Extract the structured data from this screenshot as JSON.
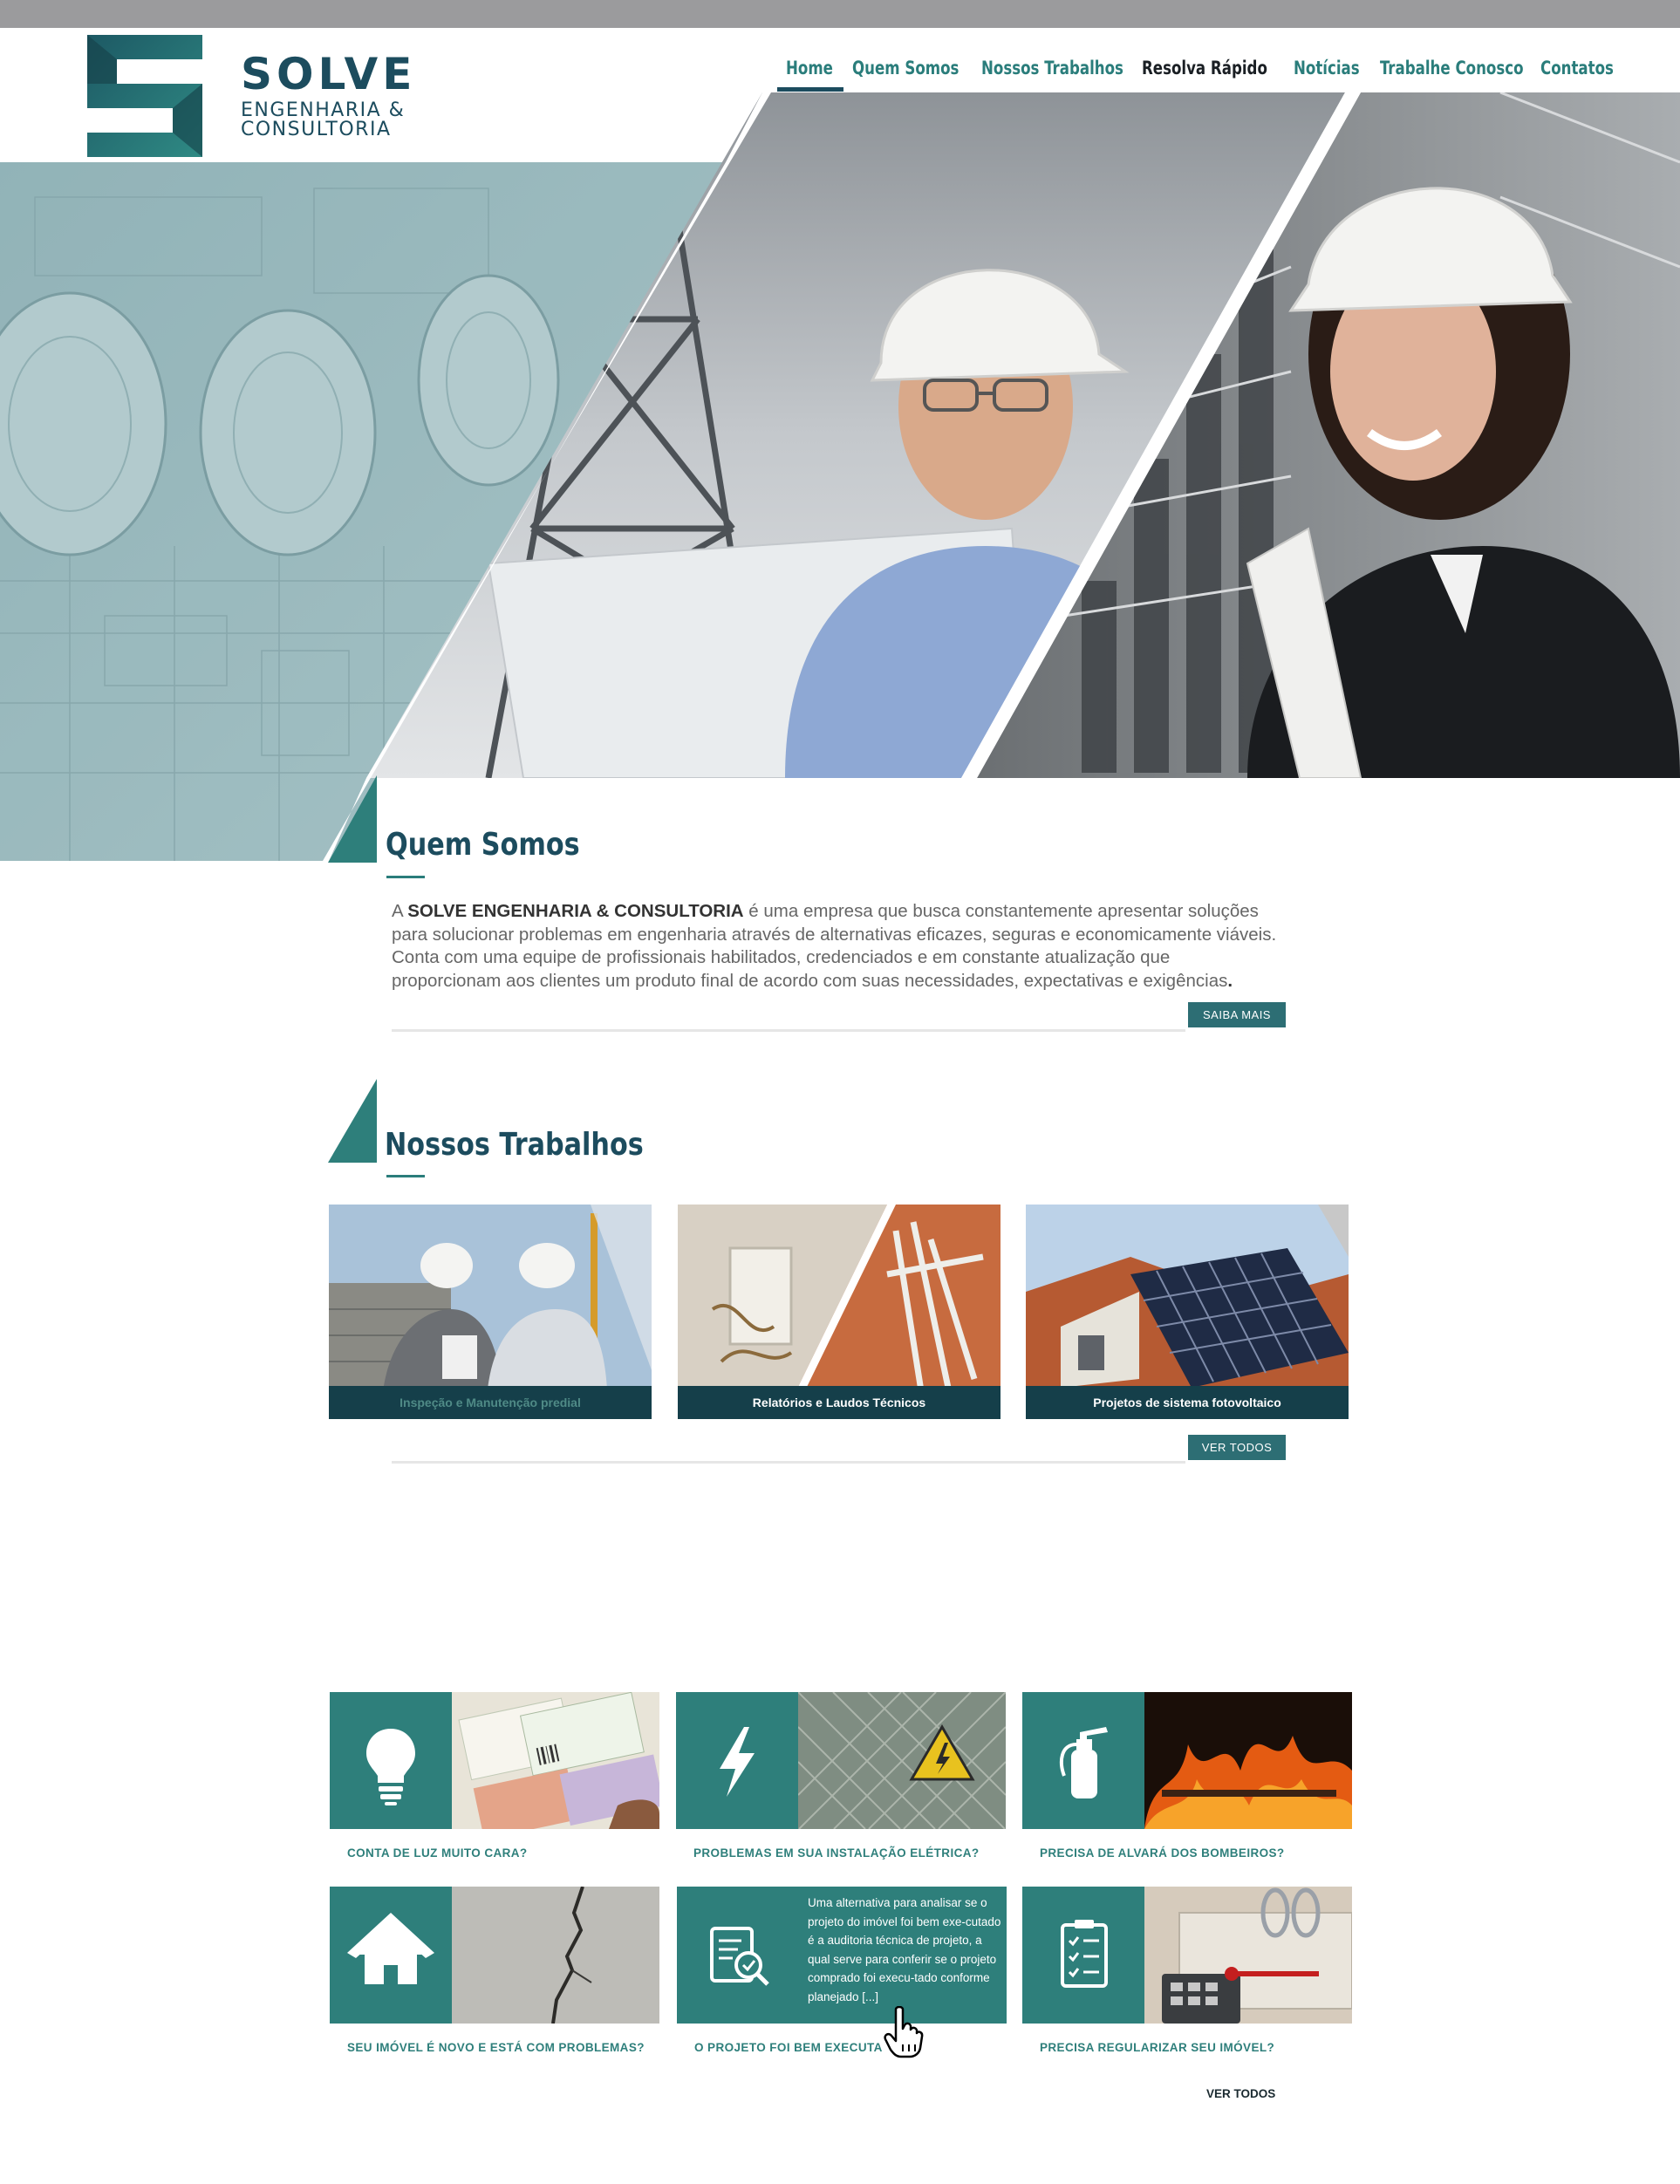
{
  "brand": {
    "name": "SOLVE",
    "sub_line1": "ENGENHARIA &",
    "sub_line2": "CONSULTORIA",
    "colors": {
      "primary": "#1c4c5e",
      "accent": "#2e7f7b",
      "dark": "#153f4a"
    }
  },
  "nav": {
    "items": [
      {
        "label": "Home",
        "active": true
      },
      {
        "label": "Quem Somos"
      },
      {
        "label": "Nossos Trabalhos"
      },
      {
        "label": "Resolva Rápido"
      },
      {
        "label": "Notícias"
      },
      {
        "label": "Trabalhe Conosco"
      },
      {
        "label": "Contatos"
      }
    ]
  },
  "about": {
    "title": "Quem Somos",
    "text_prefix": "A ",
    "company": "SOLVE ENGENHARIA & CONSULTORIA",
    "text_body": " é uma empresa que busca constantemente apresentar soluções para solucionar problemas em engenharia através de alternativas eficazes, seguras e economicamente viáveis. Conta com uma equipe de profissionais habilitados, credenciados e em constante atualização que proporcionam aos clientes um produto final de acordo com suas necessidades, expectativas e exigências",
    "text_end": ".",
    "button": "SAIBA MAIS"
  },
  "works": {
    "title": "Nossos Trabalhos",
    "cards": [
      {
        "caption": "Inspeção e Manutenção predial"
      },
      {
        "caption": "Relatórios e Laudos Técnicos"
      },
      {
        "caption": "Projetos de sistema fotovoltaico"
      }
    ],
    "button": "VER TODOS"
  },
  "quick": {
    "cards": [
      {
        "label": "CONTA DE LUZ MUITO CARA?",
        "icon": "lightbulb-icon"
      },
      {
        "label": "PROBLEMAS EM SUA INSTALAÇÃO ELÉTRICA?",
        "icon": "lightning-icon"
      },
      {
        "label": "PRECISA DE ALVARÁ DOS BOMBEIROS?",
        "icon": "fire-extinguisher-icon"
      },
      {
        "label": "SEU IMÓVEL É NOVO E ESTÁ COM PROBLEMAS?",
        "icon": "house-icon"
      },
      {
        "label": "O PROJETO FOI BEM EXECUTA",
        "icon": "document-search-icon",
        "hover_text": "Uma alternativa para analisar se o projeto do imóvel foi bem exe-cutado é a auditoria técnica de projeto, a qual serve para conferir se o projeto comprado foi execu-tado conforme planejado  [...]"
      },
      {
        "label": "PRECISA REGULARIZAR SEU IMÓVEL?",
        "icon": "clipboard-checklist-icon"
      }
    ],
    "ver_todos": "VER TODOS"
  }
}
